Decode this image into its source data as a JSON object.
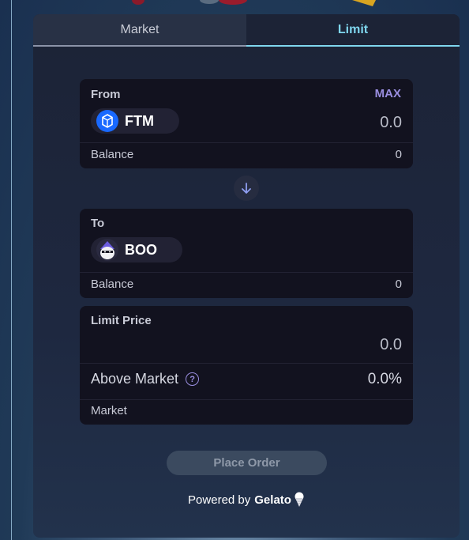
{
  "tabs": [
    {
      "label": "Market",
      "active": false
    },
    {
      "label": "Limit",
      "active": true
    }
  ],
  "from": {
    "label": "From",
    "max_label": "MAX",
    "token": {
      "symbol": "FTM",
      "icon": "fantom-token-icon"
    },
    "amount": "0.0",
    "balance_label": "Balance",
    "balance_value": "0"
  },
  "swap_icon": "arrow-down-icon",
  "to": {
    "label": "To",
    "token": {
      "symbol": "BOO",
      "icon": "boo-token-icon"
    },
    "balance_label": "Balance",
    "balance_value": "0"
  },
  "limit": {
    "label": "Limit Price",
    "amount": "0.0",
    "above_label": "Above Market",
    "above_value": "0.0%",
    "market_label": "Market"
  },
  "place_order_label": "Place Order",
  "powered_by": {
    "prefix": "Powered by",
    "brand": "Gelato",
    "icon": "gelato-icecream-icon"
  },
  "colors": {
    "accent_cyan": "#7fd6ee",
    "accent_purple": "#9a8ee0",
    "card_bg": "#12121f",
    "panel_bg": "#1c2336"
  }
}
